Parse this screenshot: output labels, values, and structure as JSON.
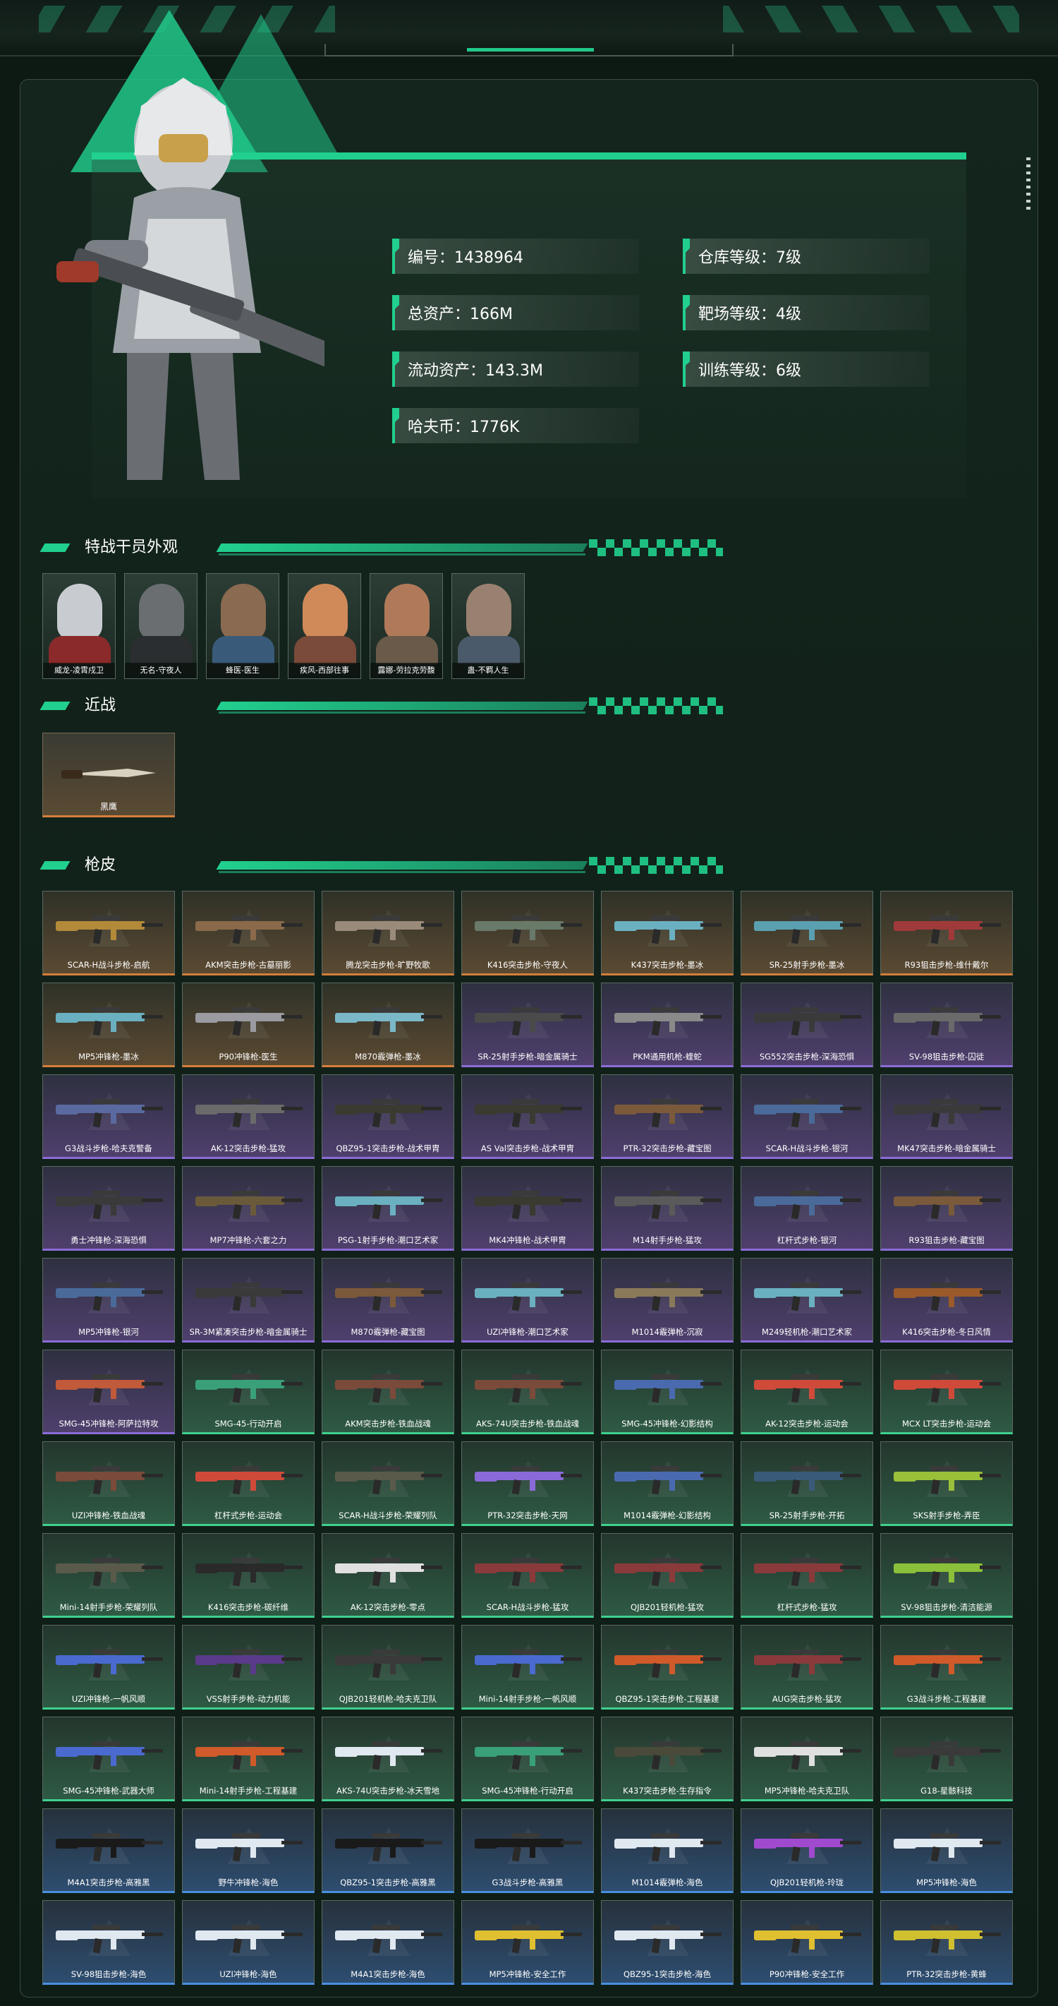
{
  "stats": {
    "id": "编号：1438964",
    "warehouse": "仓库等级：7级",
    "total_assets": "总资产：166M",
    "range": "靶场等级：4级",
    "liquid": "流动资产：143.3M",
    "training": "训练等级：6级",
    "havoc_coin": "哈夫币：1776K"
  },
  "sections": {
    "operators": "特战干员外观",
    "melee": "近战",
    "skins": "枪皮"
  },
  "operators": [
    {
      "name": "威龙-凌霄戍卫"
    },
    {
      "name": "无名-守夜人"
    },
    {
      "name": "蜂医-医生"
    },
    {
      "name": "疾风-西部往事"
    },
    {
      "name": "露娜-劳拉克劳馥"
    },
    {
      "name": "蛊-不羁人生"
    }
  ],
  "melee": {
    "name": "黑鹰"
  },
  "colors": {
    "accent": "#21d08e",
    "gold": "#d57f3a",
    "purple": "#8b6cd8",
    "green": "#3fd18e",
    "blue": "#4a90e0"
  },
  "skins": [
    {
      "name": "SCAR-H战斗步枪-启航",
      "rarity": "gold",
      "color": "#b38a3a"
    },
    {
      "name": "AKM突击步枪-古墓丽影",
      "rarity": "gold",
      "color": "#8a6a4a"
    },
    {
      "name": "腾龙突击步枪-旷野牧歌",
      "rarity": "gold",
      "color": "#9a8a7a"
    },
    {
      "name": "K416突击步枪-守夜人",
      "rarity": "gold",
      "color": "#6a7a6a"
    },
    {
      "name": "K437突击步枪-墨冰",
      "rarity": "gold",
      "color": "#6ab0c0"
    },
    {
      "name": "SR-25射手步枪-墨冰",
      "rarity": "gold",
      "color": "#5aa0b0"
    },
    {
      "name": "R93狙击步枪-维什戴尔",
      "rarity": "gold",
      "color": "#a03a3a"
    },
    {
      "name": "MP5冲锋枪-墨冰",
      "rarity": "gold",
      "color": "#6ab0c0"
    },
    {
      "name": "P90冲锋枪-医生",
      "rarity": "gold",
      "color": "#9a9aa0"
    },
    {
      "name": "M870霰弹枪-墨冰",
      "rarity": "gold",
      "color": "#7ab8c8"
    },
    {
      "name": "SR-25射手步枪-暗金属骑士",
      "rarity": "purple",
      "color": "#4a4a4a"
    },
    {
      "name": "PKM通用机枪-蝰蛇",
      "rarity": "purple",
      "color": "#8a8a8a"
    },
    {
      "name": "SG552突击步枪-深海恐惧",
      "rarity": "purple",
      "color": "#3a3a3a"
    },
    {
      "name": "SV-98狙击步枪-囚徒",
      "rarity": "purple",
      "color": "#6a6a6a"
    },
    {
      "name": "G3战斗步枪-哈夫克警备",
      "rarity": "purple",
      "color": "#5a6aa0"
    },
    {
      "name": "AK-12突击步枪-猛攻",
      "rarity": "purple",
      "color": "#6a6a6a"
    },
    {
      "name": "QBZ95-1突击步枪-战术甲胄",
      "rarity": "purple",
      "color": "#3a3a30"
    },
    {
      "name": "AS Val突击步枪-战术甲胄",
      "rarity": "purple",
      "color": "#3a3a30"
    },
    {
      "name": "PTR-32突击步枪-藏宝图",
      "rarity": "purple",
      "color": "#7a5a3a"
    },
    {
      "name": "SCAR-H战斗步枪-银河",
      "rarity": "purple",
      "color": "#4a6a9a"
    },
    {
      "name": "MK47突击步枪-暗金属骑士",
      "rarity": "purple",
      "color": "#3a3a3a"
    },
    {
      "name": "勇士冲锋枪-深海恐惧",
      "rarity": "purple",
      "color": "#3a3a3a"
    },
    {
      "name": "MP7冲锋枪-六套之力",
      "rarity": "purple",
      "color": "#6a5a3a"
    },
    {
      "name": "PSG-1射手步枪-潮口艺术家",
      "rarity": "purple",
      "color": "#6ab0c0"
    },
    {
      "name": "MK4冲锋枪-战术甲胄",
      "rarity": "purple",
      "color": "#3a3a30"
    },
    {
      "name": "M14射手步枪-猛攻",
      "rarity": "purple",
      "color": "#5a5a5a"
    },
    {
      "name": "杠杆式步枪-银河",
      "rarity": "purple",
      "color": "#4a6a9a"
    },
    {
      "name": "R93狙击步枪-藏宝图",
      "rarity": "purple",
      "color": "#7a5a3a"
    },
    {
      "name": "MP5冲锋枪-银河",
      "rarity": "purple",
      "color": "#4a6a9a"
    },
    {
      "name": "SR-3M紧凑突击步枪-暗金属骑士",
      "rarity": "purple",
      "color": "#3a3a3a"
    },
    {
      "name": "M870霰弹枪-藏宝图",
      "rarity": "purple",
      "color": "#7a5a3a"
    },
    {
      "name": "UZI冲锋枪-潮口艺术家",
      "rarity": "purple",
      "color": "#6ab0c0"
    },
    {
      "name": "M1014霰弹枪-沉寂",
      "rarity": "purple",
      "color": "#8a7a5a"
    },
    {
      "name": "M249轻机枪-潮口艺术家",
      "rarity": "purple",
      "color": "#6ab0c0"
    },
    {
      "name": "K416突击步枪-冬日风情",
      "rarity": "purple",
      "color": "#9a5a2a"
    },
    {
      "name": "SMG-45冲锋枪-阿萨拉特攻",
      "rarity": "purple",
      "color": "#c05a3a"
    },
    {
      "name": "SMG-45-行动开启",
      "rarity": "green",
      "color": "#3aa07a"
    },
    {
      "name": "AKM突击步枪-铁血战魂",
      "rarity": "green",
      "color": "#7a4a3a"
    },
    {
      "name": "AKS-74U突击步枪-铁血战魂",
      "rarity": "green",
      "color": "#7a4a3a"
    },
    {
      "name": "SMG-45冲锋枪-幻影结构",
      "rarity": "green",
      "color": "#4a6ab0"
    },
    {
      "name": "AK-12突击步枪-运动会",
      "rarity": "green",
      "color": "#d04a3a"
    },
    {
      "name": "MCX LT突击步枪-运动会",
      "rarity": "green",
      "color": "#d04a3a"
    },
    {
      "name": "UZI冲锋枪-铁血战魂",
      "rarity": "green",
      "color": "#7a4a3a"
    },
    {
      "name": "杠杆式步枪-运动会",
      "rarity": "green",
      "color": "#d04a3a"
    },
    {
      "name": "SCAR-H战斗步枪-荣耀列队",
      "rarity": "green",
      "color": "#5a5a4a"
    },
    {
      "name": "PTR-32突击步枪-天网",
      "rarity": "green",
      "color": "#8a6ad8"
    },
    {
      "name": "M1014霰弹枪-幻影结构",
      "rarity": "green",
      "color": "#4a6ab0"
    },
    {
      "name": "SR-25射手步枪-开拓",
      "rarity": "green",
      "color": "#3a5a7a"
    },
    {
      "name": "SKS射手步枪-弄臣",
      "rarity": "green",
      "color": "#9ac03a"
    },
    {
      "name": "Mini-14射手步枪-荣耀列队",
      "rarity": "green",
      "color": "#5a5a4a"
    },
    {
      "name": "K416突击步枪-碳纤维",
      "rarity": "green",
      "color": "#2a2a2a"
    },
    {
      "name": "AK-12突击步枪-零点",
      "rarity": "green",
      "color": "#e0e0e0"
    },
    {
      "name": "SCAR-H战斗步枪-猛攻",
      "rarity": "green",
      "color": "#8a3a3a"
    },
    {
      "name": "QJB201轻机枪-猛攻",
      "rarity": "green",
      "color": "#8a3a3a"
    },
    {
      "name": "杠杆式步枪-猛攻",
      "rarity": "green",
      "color": "#8a3a3a"
    },
    {
      "name": "SV-98狙击步枪-清洁能源",
      "rarity": "green",
      "color": "#8ac03a"
    },
    {
      "name": "UZI冲锋枪-一帆风顺",
      "rarity": "green",
      "color": "#4a6ad0"
    },
    {
      "name": "VSS射手步枪-动力机能",
      "rarity": "green",
      "color": "#5a3a8a"
    },
    {
      "name": "QJB201轻机枪-哈夫克卫队",
      "rarity": "green",
      "color": "#3a3a3a"
    },
    {
      "name": "Mini-14射手步枪-一帆风顺",
      "rarity": "green",
      "color": "#4a6ad0"
    },
    {
      "name": "QBZ95-1突击步枪-工程基建",
      "rarity": "green",
      "color": "#d05a2a"
    },
    {
      "name": "AUG突击步枪-猛攻",
      "rarity": "green",
      "color": "#8a3a3a"
    },
    {
      "name": "G3战斗步枪-工程基建",
      "rarity": "green",
      "color": "#d05a2a"
    },
    {
      "name": "SMG-45冲锋枪-武器大师",
      "rarity": "green",
      "color": "#4a6ad0"
    },
    {
      "name": "Mini-14射手步枪-工程基建",
      "rarity": "green",
      "color": "#d05a2a"
    },
    {
      "name": "AKS-74U突击步枪-冰天雪地",
      "rarity": "green",
      "color": "#e0e8f0"
    },
    {
      "name": "SMG-45冲锋枪-行动开启",
      "rarity": "green",
      "color": "#3aa07a"
    },
    {
      "name": "K437突击步枪-生存指令",
      "rarity": "green",
      "color": "#4a4a3a"
    },
    {
      "name": "MP5冲锋枪-哈夫克卫队",
      "rarity": "green",
      "color": "#e0e0e0"
    },
    {
      "name": "G18-星骸科技",
      "rarity": "green",
      "color": "#3a3a3a"
    },
    {
      "name": "M4A1突击步枪-高雅黑",
      "rarity": "blue",
      "color": "#1a1a1a"
    },
    {
      "name": "野牛冲锋枪-海色",
      "rarity": "blue",
      "color": "#e0e8f0"
    },
    {
      "name": "QBZ95-1突击步枪-高雅黑",
      "rarity": "blue",
      "color": "#1a1a1a"
    },
    {
      "name": "G3战斗步枪-高雅黑",
      "rarity": "blue",
      "color": "#1a1a1a"
    },
    {
      "name": "M1014霰弹枪-海色",
      "rarity": "blue",
      "color": "#e0e8f0"
    },
    {
      "name": "QJB201轻机枪-玲珑",
      "rarity": "blue",
      "color": "#a04ad0"
    },
    {
      "name": "MP5冲锋枪-海色",
      "rarity": "blue",
      "color": "#e0e8f0"
    },
    {
      "name": "SV-98狙击步枪-海色",
      "rarity": "blue",
      "color": "#e0e8f0"
    },
    {
      "name": "UZI冲锋枪-海色",
      "rarity": "blue",
      "color": "#e0e8f0"
    },
    {
      "name": "M4A1突击步枪-海色",
      "rarity": "blue",
      "color": "#e0e8f0"
    },
    {
      "name": "MP5冲锋枪-安全工作",
      "rarity": "blue",
      "color": "#e0c030"
    },
    {
      "name": "QBZ95-1突击步枪-海色",
      "rarity": "blue",
      "color": "#e0e8f0"
    },
    {
      "name": "P90冲锋枪-安全工作",
      "rarity": "blue",
      "color": "#e0c030"
    },
    {
      "name": "PTR-32突击步枪-黄蜂",
      "rarity": "blue",
      "color": "#d0c030"
    }
  ]
}
